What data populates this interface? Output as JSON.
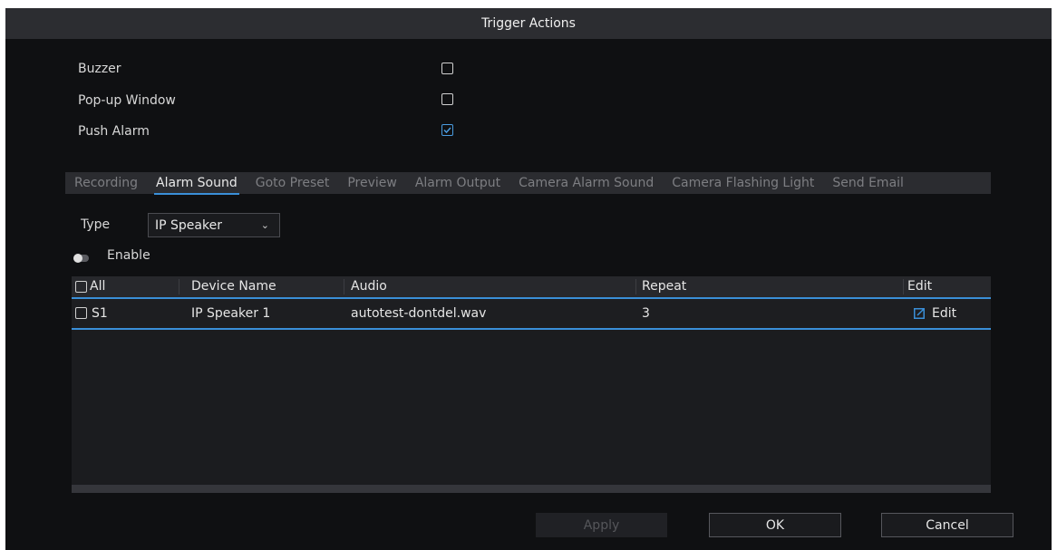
{
  "dialog": {
    "title": "Trigger Actions"
  },
  "options": [
    {
      "label": "Buzzer",
      "checked": false
    },
    {
      "label": "Pop-up Window",
      "checked": false
    },
    {
      "label": "Push Alarm",
      "checked": true
    }
  ],
  "tabs": [
    {
      "label": "Recording",
      "active": false
    },
    {
      "label": "Alarm Sound",
      "active": true
    },
    {
      "label": "Goto Preset",
      "active": false
    },
    {
      "label": "Preview",
      "active": false
    },
    {
      "label": "Alarm Output",
      "active": false
    },
    {
      "label": "Camera Alarm Sound",
      "active": false
    },
    {
      "label": "Camera Flashing Light",
      "active": false
    },
    {
      "label": "Send Email",
      "active": false
    }
  ],
  "type_field": {
    "label": "Type",
    "value": "IP Speaker"
  },
  "enable": {
    "label": "Enable",
    "on": false
  },
  "table": {
    "columns": [
      "All",
      "Device Name",
      "Audio",
      "Repeat",
      "Edit"
    ],
    "rows": [
      {
        "id": "S1",
        "device_name": "IP Speaker 1",
        "audio": "autotest-dontdel.wav",
        "repeat": "3",
        "edit": "Edit"
      }
    ]
  },
  "buttons": {
    "apply": "Apply",
    "ok": "OK",
    "cancel": "Cancel"
  },
  "colors": {
    "accent": "#3a8fd8",
    "background": "#0f1012",
    "title_bar": "#2c2d31"
  }
}
